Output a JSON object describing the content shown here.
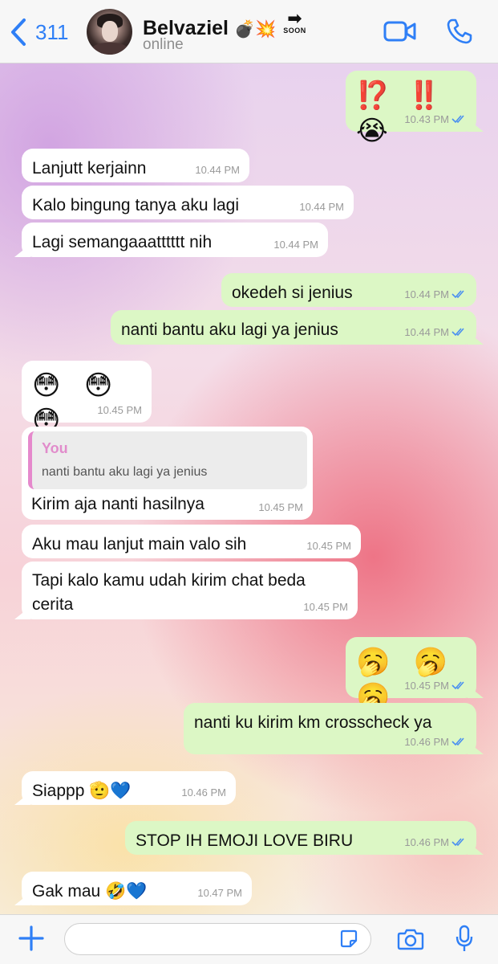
{
  "header": {
    "back_count": "311",
    "contact_name": "Belvaziel",
    "name_emojis": "💣💥",
    "soon_arrow": "➡",
    "soon_label": "SOON",
    "status": "online"
  },
  "messages": [
    {
      "dir": "out",
      "text": "⁉️ ‼️ 😭",
      "time": "10.43 PM"
    },
    {
      "dir": "in",
      "text": "Lanjutt kerjainn",
      "time": "10.44 PM"
    },
    {
      "dir": "in",
      "text": "Kalo bingung tanya aku lagi",
      "time": "10.44 PM"
    },
    {
      "dir": "in",
      "text": "Lagi semangaaatttttt nih",
      "time": "10.44 PM"
    },
    {
      "dir": "out",
      "text": "okedeh si jenius",
      "time": "10.44 PM"
    },
    {
      "dir": "out",
      "text": "nanti bantu aku lagi ya jenius",
      "time": "10.44 PM"
    },
    {
      "dir": "in",
      "text": "😳 😳 😳",
      "time": "10.45 PM"
    },
    {
      "dir": "in",
      "quote_name": "You",
      "quote_text": "nanti bantu aku lagi ya jenius",
      "text": "Kirim aja nanti hasilnya",
      "time": "10.45 PM"
    },
    {
      "dir": "in",
      "text": "Aku mau lanjut main valo sih",
      "time": "10.45 PM"
    },
    {
      "dir": "in",
      "text": "Tapi kalo kamu udah kirim chat beda cerita",
      "time": "10.45 PM"
    },
    {
      "dir": "out",
      "text": "🥱 🥱 🥱",
      "time": "10.45 PM"
    },
    {
      "dir": "out",
      "text": "nanti ku kirim km crosscheck ya",
      "time": "10.46 PM"
    },
    {
      "dir": "in",
      "text": "Siappp 🫡💙",
      "time": "10.46 PM"
    },
    {
      "dir": "out",
      "text": "STOP IH EMOJI LOVE BIRU",
      "time": "10.46 PM"
    },
    {
      "dir": "in",
      "text": "Gak mau 🤣💙",
      "time": "10.47 PM"
    }
  ],
  "input": {
    "placeholder": "",
    "value": ""
  },
  "colors": {
    "accent": "#2f7ff6",
    "outgoing_bubble": "#dcf7c5",
    "incoming_bubble": "#ffffff",
    "read_check": "#4a8ff0",
    "quote_name": "#e18ccb"
  },
  "icons": {
    "back": "chevron-left-icon",
    "video": "video-camera-icon",
    "call": "phone-icon",
    "read_receipt": "double-check-icon",
    "plus": "plus-icon",
    "sticker": "sticker-icon",
    "camera": "camera-icon",
    "mic": "microphone-icon"
  }
}
